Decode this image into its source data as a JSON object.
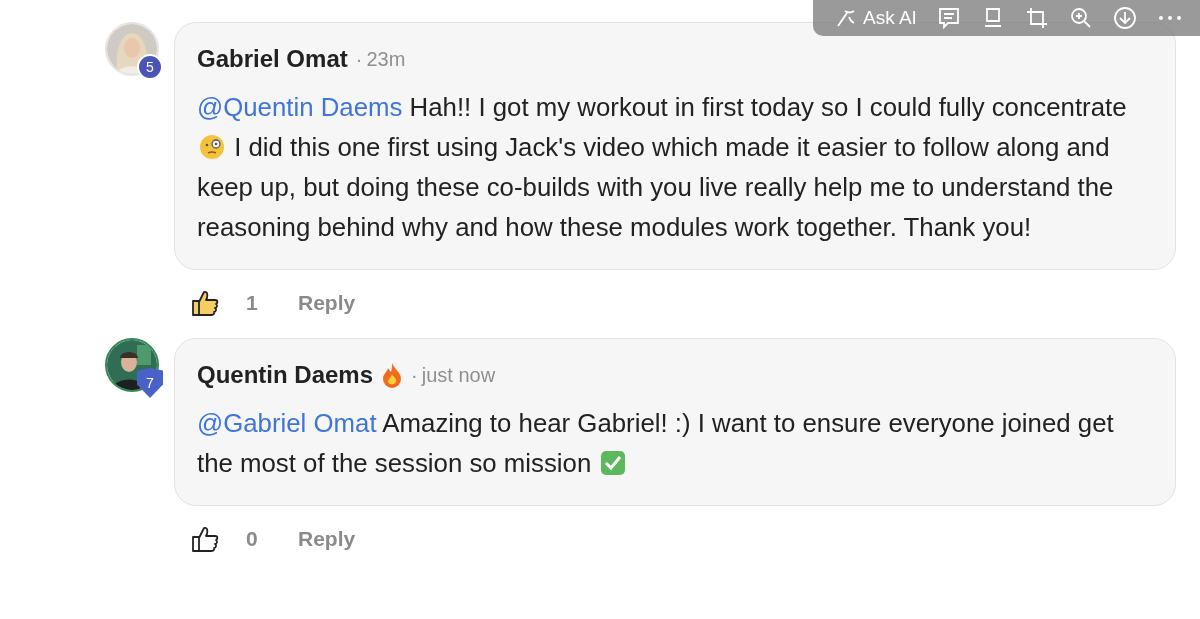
{
  "toolbar": {
    "ask_ai": "Ask AI"
  },
  "comments": [
    {
      "author": "Gabriel Omat",
      "dot": "·",
      "time": "23m",
      "badge": {
        "kind": "circle",
        "text": "5"
      },
      "body": [
        {
          "kind": "mention",
          "text": "@Quentin Daems"
        },
        {
          "kind": "text",
          "text": " Hah!! I got my workout in first today so I could fully concentrate "
        },
        {
          "kind": "monocle-emoji"
        },
        {
          "kind": "text",
          "text": " I did this one first using Jack's video which made it easier to follow along and keep up, but doing these co-builds with you live really help me to understand the reasoning behind why and how these modules work together. Thank you!"
        }
      ],
      "liked": true,
      "likes": "1",
      "reply": "Reply"
    },
    {
      "author": "Quentin Daems",
      "name_extras": [
        {
          "kind": "fire-emoji"
        }
      ],
      "dot": "·",
      "time": "just now",
      "badge": {
        "kind": "shield",
        "text": "7"
      },
      "body": [
        {
          "kind": "mention",
          "text": "@Gabriel Omat"
        },
        {
          "kind": "text",
          "text": " Amazing to hear Gabriel! :) I want to ensure everyone joined get the most of the session so mission "
        },
        {
          "kind": "check-emoji"
        }
      ],
      "liked": false,
      "likes": "0",
      "reply": "Reply"
    }
  ]
}
